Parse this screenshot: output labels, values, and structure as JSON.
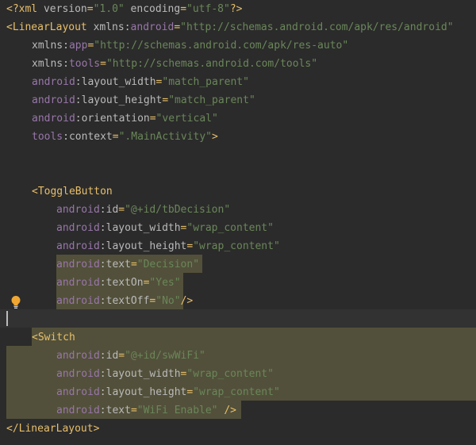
{
  "lines": [
    {
      "id": "l1",
      "parts": [
        [
          "punc",
          "<?"
        ],
        [
          "tag",
          "xml "
        ],
        [
          "attr",
          "version"
        ],
        [
          "punc",
          "="
        ],
        [
          "val",
          "\"1.0\""
        ],
        [
          "attr",
          " encoding"
        ],
        [
          "punc",
          "="
        ],
        [
          "val",
          "\"utf-8\""
        ],
        [
          "punc",
          "?>"
        ]
      ]
    },
    {
      "id": "l2",
      "parts": [
        [
          "punc",
          "<"
        ],
        [
          "tag",
          "LinearLayout "
        ],
        [
          "attr",
          "xmlns:"
        ],
        [
          "ns",
          "android"
        ],
        [
          "punc",
          "="
        ],
        [
          "val",
          "\"http://schemas.android.com/apk/res/android\""
        ]
      ]
    },
    {
      "id": "l3",
      "parts": [
        [
          "attr",
          "xmlns:"
        ],
        [
          "ns",
          "app"
        ],
        [
          "punc",
          "="
        ],
        [
          "val",
          "\"http://schemas.android.com/apk/res-auto\""
        ]
      ]
    },
    {
      "id": "l4",
      "parts": [
        [
          "attr",
          "xmlns:"
        ],
        [
          "ns",
          "tools"
        ],
        [
          "punc",
          "="
        ],
        [
          "val",
          "\"http://schemas.android.com/tools\""
        ]
      ]
    },
    {
      "id": "l5",
      "parts": [
        [
          "ns",
          "android"
        ],
        [
          "attr",
          ":layout_width"
        ],
        [
          "punc",
          "="
        ],
        [
          "val",
          "\"match_parent\""
        ]
      ]
    },
    {
      "id": "l6",
      "parts": [
        [
          "ns",
          "android"
        ],
        [
          "attr",
          ":layout_height"
        ],
        [
          "punc",
          "="
        ],
        [
          "val",
          "\"match_parent\""
        ]
      ]
    },
    {
      "id": "l7",
      "parts": [
        [
          "ns",
          "android"
        ],
        [
          "attr",
          ":orientation"
        ],
        [
          "punc",
          "="
        ],
        [
          "val",
          "\"vertical\""
        ]
      ]
    },
    {
      "id": "l8",
      "parts": [
        [
          "ns",
          "tools"
        ],
        [
          "attr",
          ":context"
        ],
        [
          "punc",
          "="
        ],
        [
          "val",
          "\".MainActivity\""
        ],
        [
          "punc",
          ">"
        ]
      ]
    },
    {
      "id": "l9",
      "parts": [
        [
          "punc",
          "<"
        ],
        [
          "tag",
          "ToggleButton"
        ]
      ]
    },
    {
      "id": "l10",
      "parts": [
        [
          "ns",
          "android"
        ],
        [
          "attr",
          ":id"
        ],
        [
          "punc",
          "="
        ],
        [
          "val",
          "\"@+id/tbDecision\""
        ]
      ]
    },
    {
      "id": "l11",
      "parts": [
        [
          "ns",
          "android"
        ],
        [
          "attr",
          ":layout_width"
        ],
        [
          "punc",
          "="
        ],
        [
          "val",
          "\"wrap_content\""
        ]
      ]
    },
    {
      "id": "l12",
      "parts": [
        [
          "ns",
          "android"
        ],
        [
          "attr",
          ":layout_height"
        ],
        [
          "punc",
          "="
        ],
        [
          "val",
          "\"wrap_content\""
        ]
      ]
    },
    {
      "id": "l13",
      "parts": [
        [
          "ns",
          "android"
        ],
        [
          "attr",
          ":text"
        ],
        [
          "punc",
          "="
        ],
        [
          "val",
          "\"Decision\""
        ]
      ]
    },
    {
      "id": "l14",
      "parts": [
        [
          "ns",
          "android"
        ],
        [
          "attr",
          ":textOn"
        ],
        [
          "punc",
          "="
        ],
        [
          "val",
          "\"Yes\""
        ]
      ]
    },
    {
      "id": "l15",
      "parts": [
        [
          "ns",
          "android"
        ],
        [
          "attr",
          ":textOff"
        ],
        [
          "punc",
          "="
        ],
        [
          "val",
          "\"No\""
        ],
        [
          "punc",
          "/>"
        ]
      ]
    },
    {
      "id": "l16",
      "parts": [
        [
          "punc",
          "<"
        ],
        [
          "tag",
          "Switch"
        ]
      ]
    },
    {
      "id": "l17",
      "parts": [
        [
          "ns",
          "android"
        ],
        [
          "attr",
          ":id"
        ],
        [
          "punc",
          "="
        ],
        [
          "val",
          "\"@+id/swWiFi\""
        ]
      ]
    },
    {
      "id": "l18",
      "parts": [
        [
          "ns",
          "android"
        ],
        [
          "attr",
          ":layout_width"
        ],
        [
          "punc",
          "="
        ],
        [
          "val",
          "\"wrap_content\""
        ]
      ]
    },
    {
      "id": "l19",
      "parts": [
        [
          "ns",
          "android"
        ],
        [
          "attr",
          ":layout_height"
        ],
        [
          "punc",
          "="
        ],
        [
          "val",
          "\"wrap_content\""
        ]
      ]
    },
    {
      "id": "l20",
      "parts": [
        [
          "ns",
          "android"
        ],
        [
          "attr",
          ":text"
        ],
        [
          "punc",
          "="
        ],
        [
          "val",
          "\"WiFi Enable\""
        ],
        [
          "punc",
          " />"
        ]
      ]
    },
    {
      "id": "l21",
      "parts": [
        [
          "punc",
          "</"
        ],
        [
          "tag",
          "LinearLayout"
        ],
        [
          "punc",
          ">"
        ]
      ]
    }
  ],
  "icons": {
    "intention": "lightbulb-icon"
  },
  "colors": {
    "background": "#2b2b2b",
    "tag": "#e8bf6a",
    "namespace": "#9876aa",
    "attribute": "#bababa",
    "value": "#6a8759",
    "highlight": "#52503a"
  }
}
